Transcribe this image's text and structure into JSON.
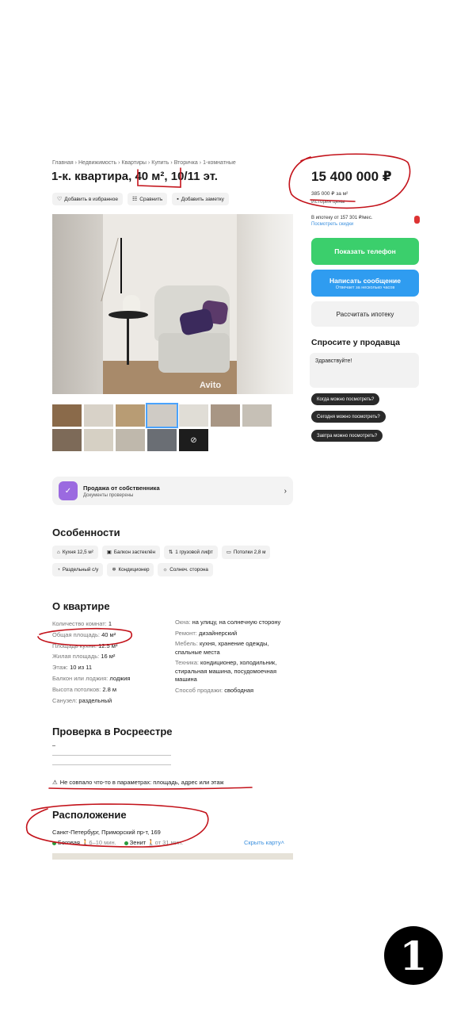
{
  "breadcrumb": [
    "Главная",
    "Недвижимость",
    "Квартиры",
    "Купить",
    "Вторичка",
    "1-комнатные"
  ],
  "listing": {
    "title_part1": "1-к. квартира,",
    "title_area": "40 м²",
    "title_part2": ", 10/11 эт."
  },
  "actions": {
    "favorite": "Добавить в избранное",
    "compare": "Сравнить",
    "note": "Добавить заметку"
  },
  "photo": {
    "watermark": "Avito",
    "thumb_count": 14,
    "selected_thumb": 4
  },
  "owner_badge": {
    "title": "Продажа от собственника",
    "subtitle": "Документы проверены"
  },
  "features": {
    "heading": "Особенности",
    "chips": [
      {
        "icon": "kitchen-icon",
        "text": "Кухня 12,5 м²"
      },
      {
        "icon": "balcony-icon",
        "text": "Балкон застеклён"
      },
      {
        "icon": "elevator-icon",
        "text": "1 грузовой лифт"
      },
      {
        "icon": "ceiling-icon",
        "text": "Потолки 2,8 м"
      },
      {
        "icon": "bathroom-icon",
        "text": "Раздельный с/у"
      },
      {
        "icon": "ac-icon",
        "text": "Кондиционер"
      },
      {
        "icon": "sun-icon",
        "text": "Солнеч. сторона"
      }
    ]
  },
  "about": {
    "heading": "О квартире",
    "left": [
      {
        "label": "Количество комнат:",
        "value": "1"
      },
      {
        "label": "Общая площадь:",
        "value": "40 м²"
      },
      {
        "label": "Площадь кухни:",
        "value": "12.5 м²"
      },
      {
        "label": "Жилая площадь:",
        "value": "16 м²"
      },
      {
        "label": "Этаж:",
        "value": "10 из 11"
      },
      {
        "label": "Балкон или лоджия:",
        "value": "лоджия"
      },
      {
        "label": "Высота потолков:",
        "value": "2.8 м"
      },
      {
        "label": "Санузел:",
        "value": "раздельный"
      }
    ],
    "right": [
      {
        "label": "Окна:",
        "value": "на улицу, на солнечную сторону"
      },
      {
        "label": "Ремонт:",
        "value": "дизайнерский"
      },
      {
        "label": "Мебель:",
        "value": "кухня, хранение одежды, спальные места"
      },
      {
        "label": "Техника:",
        "value": "кондиционер, холодильник, стиральная машина, посудомоечная машина"
      },
      {
        "label": "Способ продажи:",
        "value": "свободная"
      }
    ]
  },
  "rosreestr": {
    "heading": "Проверка в Росреестре",
    "warning": "Не совпало что-то в параметрах: площадь, адрес или этаж"
  },
  "location": {
    "heading": "Расположение",
    "address": "Санкт-Петербург, Приморский пр-т, 169",
    "metro": [
      {
        "name": "Беговая",
        "time": "6–10 мин."
      },
      {
        "name": "Зенит",
        "time": "от 31 мин."
      }
    ],
    "hide_map": "Скрыть карту"
  },
  "sidebar": {
    "price": "15 400 000 ₽",
    "price_per_m2": "385 000 ₽ за м²",
    "price_history": "История цены",
    "mortgage": "В ипотеку от 157 301 ₽/мес.",
    "discount": "Посмотреть скидки",
    "show_phone": "Показать телефон",
    "write_message": "Написать сообщение",
    "write_sub": "Отвечает за несколько часов",
    "calc_mortgage": "Рассчитать ипотеку",
    "ask_heading": "Спросите у продавца",
    "ask_placeholder": "Здравствуйте!",
    "questions": [
      "Когда можно посмотреть?",
      "Сегодня можно посмотреть?",
      "Завтра можно посмотреть?"
    ]
  },
  "page_number": "1",
  "colors": {
    "accent_green": "#3bcf6c",
    "accent_blue": "#2f9cf0",
    "annotation_red": "#c3121a"
  }
}
